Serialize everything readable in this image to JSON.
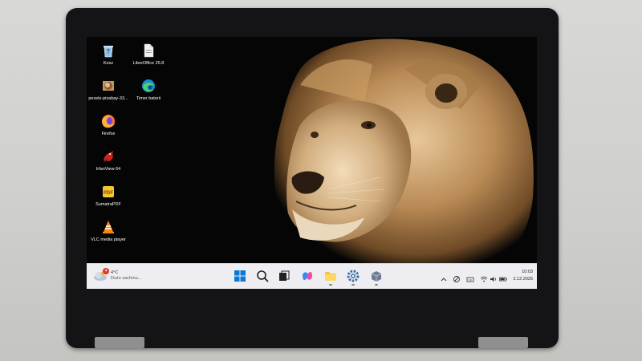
{
  "desktop": {
    "icons": [
      {
        "label": "Kosz",
        "icon": "recycle-bin-icon"
      },
      {
        "label": "LibreOffice 25.8",
        "icon": "libreoffice-icon"
      },
      {
        "label": "pexels-pixabay-33...",
        "icon": "image-file-icon"
      },
      {
        "label": "Timer baterii",
        "icon": "edge-icon"
      },
      {
        "label": "Firefox",
        "icon": "firefox-icon"
      },
      {
        "label": "IrfanView 64",
        "icon": "irfanview-icon"
      },
      {
        "label": "SumatraPDF",
        "icon": "sumatrapdf-icon"
      },
      {
        "label": "VLC media player",
        "icon": "vlc-icon"
      }
    ]
  },
  "taskbar": {
    "weather": {
      "temp": "4°C",
      "condition": "Dużo zachmu...",
      "badge": "4"
    },
    "pinned": [
      "start-icon",
      "search-icon",
      "task-view-icon",
      "copilot-icon",
      "file-explorer-icon",
      "settings-icon",
      "app-icon"
    ],
    "tray": [
      "chevron-up-icon",
      "vpn-icon",
      "keyboard-icon",
      "wifi-icon",
      "volume-icon",
      "battery-icon"
    ],
    "clock": {
      "time": "10:03",
      "date": "2.12.2025"
    }
  },
  "colors": {
    "taskbar_bg": "#eeeef2",
    "accent": "#0067c0",
    "desktop_bg": "#050505"
  }
}
